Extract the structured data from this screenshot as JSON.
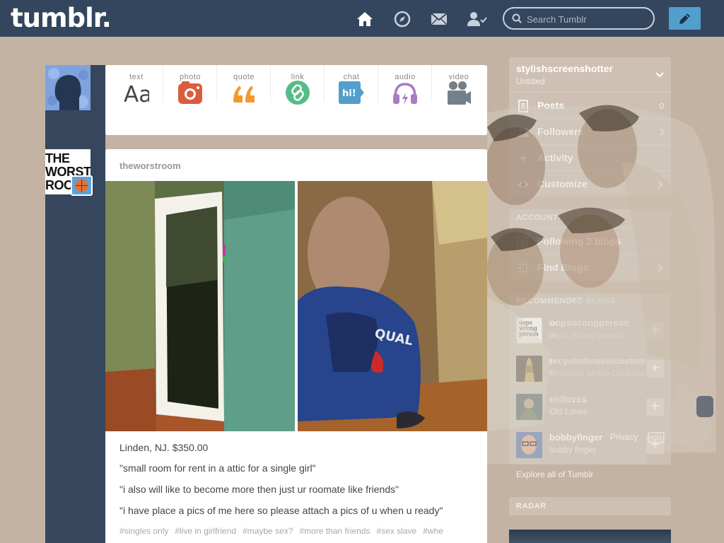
{
  "header": {
    "logo": "tumblr.",
    "search_placeholder": "Search Tumblr",
    "nav_icons": [
      "home-icon",
      "explore-compass-icon",
      "inbox-mail-icon",
      "account-person-icon"
    ],
    "compose_icon": "pencil-icon"
  },
  "post_types": [
    {
      "label": "text",
      "icon": "text-aa-icon"
    },
    {
      "label": "photo",
      "icon": "camera-icon",
      "color": "#d95e40"
    },
    {
      "label": "quote",
      "icon": "quote-marks-icon",
      "color": "#f2992e"
    },
    {
      "label": "link",
      "icon": "link-chain-icon",
      "color": "#56bc8a"
    },
    {
      "label": "chat",
      "icon": "chat-bubble-icon",
      "color": "#529ecc",
      "text": "hi!"
    },
    {
      "label": "audio",
      "icon": "headphones-icon",
      "color": "#a77dc2"
    },
    {
      "label": "video",
      "icon": "video-camera-icon",
      "color": "#748089"
    }
  ],
  "blog_avatar": {
    "text": "THE WORST ROO"
  },
  "post": {
    "author": "theworstroom",
    "lines": [
      "Linden, NJ. $350.00",
      "\"small room for rent in a attic for a single girl\"",
      "\"i also will like to become more then just ur roomate like friends\"",
      "\"i have place a pics of me here so please attach a pics of u when u ready\""
    ],
    "tags": [
      "#singles only",
      "#live in girlfriend",
      "#maybe sex?",
      "#more than friends",
      "#sex slave",
      "#whe"
    ]
  },
  "sidebar": {
    "blog_name": "stylishscreenshotter",
    "blog_subtitle": "Untitled",
    "rows": [
      {
        "label": "Posts",
        "count": "0",
        "icon": "document-icon"
      },
      {
        "label": "Followers",
        "count": "3",
        "icon": "people-icon"
      },
      {
        "label": "Activity",
        "count": "",
        "icon": "lightning-icon"
      },
      {
        "label": "Customize",
        "count": "",
        "icon": "eye-icon"
      }
    ],
    "account_heading": "ACCOUNT",
    "account_rows": [
      {
        "label": "Following 2 blogs",
        "icon": "add-person-icon"
      },
      {
        "label": "Find Blogs",
        "icon": "sparkle-icon"
      }
    ],
    "recommended_heading": "RECOMMENDED BLOGS",
    "recommended": [
      {
        "name": "oopswrongperson",
        "subtitle": "oops, wrong person",
        "thumb_text": "oops wrong person"
      },
      {
        "name": "recycledmoviecostumes",
        "subtitle": "Recycled Movie Costumes"
      },
      {
        "name": "oldloves",
        "subtitle": "Old Loves"
      },
      {
        "name": "bobbyfinger",
        "subtitle": "bobby finger"
      }
    ],
    "privacy_label": "Privacy",
    "explore_label": "Explore all of Tumblr",
    "radar_heading": "RADAR"
  },
  "colors": {
    "header_bg": "#34465d",
    "page_bg": "#c4b3a3",
    "compose_bg": "#529ecc"
  }
}
